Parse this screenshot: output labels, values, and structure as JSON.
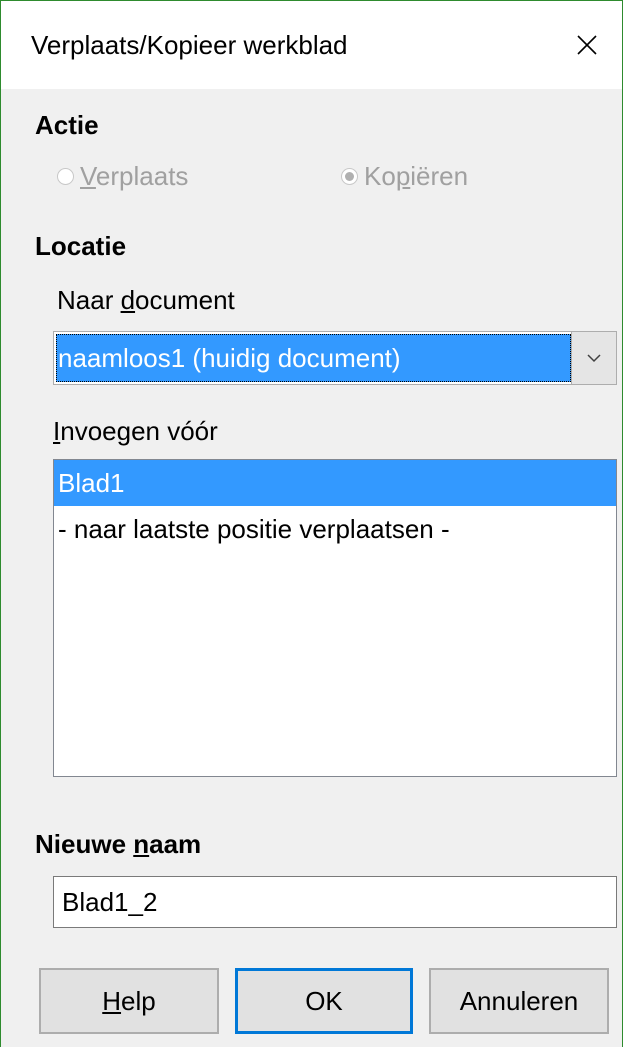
{
  "dialog": {
    "title": "Verplaats/Kopieer werkblad",
    "close_icon": "close-icon"
  },
  "action": {
    "heading": "Actie",
    "move_first": "V",
    "move_rest": "erplaats",
    "copy_first": "Ko",
    "copy_u": "p",
    "copy_rest": "iëren",
    "selected": "copy"
  },
  "location": {
    "heading": "Locatie",
    "to_document_pre": "Naar ",
    "to_document_u": "d",
    "to_document_rest": "ocument",
    "document_value": "naamloos1 (huidig document)",
    "insert_before_u": "I",
    "insert_before_rest": "nvoegen vóór",
    "insert_before_items": [
      "Blad1",
      "- naar laatste positie verplaatsen -"
    ],
    "selected_index": 0
  },
  "new_name": {
    "heading_pre": "Nieuwe ",
    "heading_u": "n",
    "heading_rest": "aam",
    "value": "Blad1_2"
  },
  "buttons": {
    "help_u": "H",
    "help_rest": "elp",
    "ok": "OK",
    "cancel": "Annuleren"
  },
  "colors": {
    "selection": "#3399ff",
    "default_button_border": "#0078d7",
    "window_border": "#2e8b2e"
  }
}
